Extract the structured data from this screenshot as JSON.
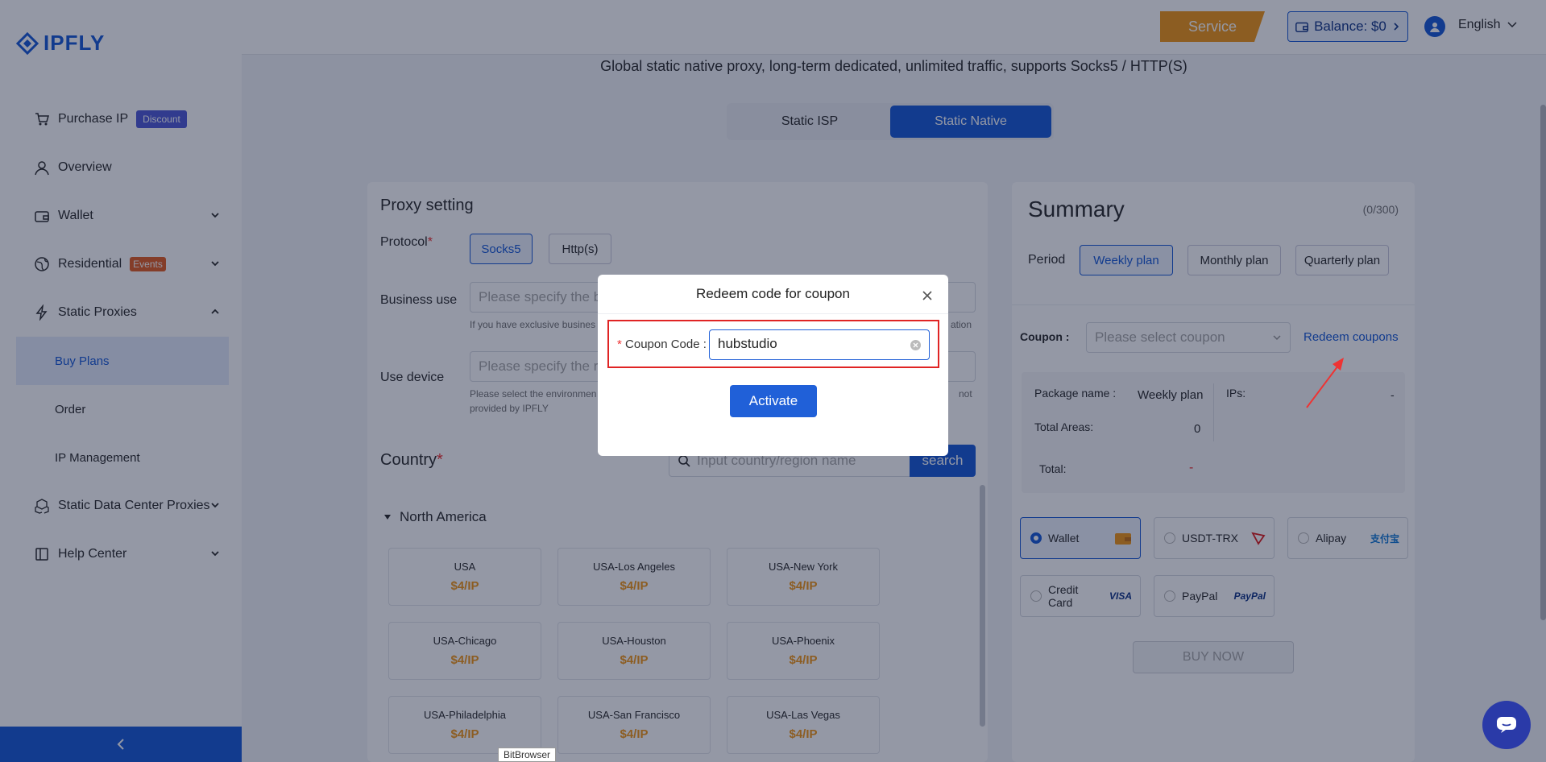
{
  "brand": {
    "logo_text": "IPFLY",
    "accent": "#2060d8"
  },
  "sidebar": {
    "items": [
      {
        "label": "Purchase IP",
        "icon": "cart-icon",
        "badge": "Discount"
      },
      {
        "label": "Overview",
        "icon": "user-icon"
      },
      {
        "label": "Wallet",
        "icon": "wallet-icon"
      },
      {
        "label": "Residential",
        "icon": "globe-icon",
        "badge": "Events"
      },
      {
        "label": "Static Proxies",
        "icon": "bolt-icon"
      },
      {
        "label": "Static Data Center Proxies",
        "icon": "cubes-icon"
      },
      {
        "label": "Help Center",
        "icon": "book-icon"
      }
    ],
    "sub_items": [
      "Buy Plans",
      "Order",
      "IP Management"
    ]
  },
  "header": {
    "service": "Service",
    "balance": "Balance: $0",
    "language": "English"
  },
  "tagline": "Global static native proxy, long-term dedicated, unlimited traffic, supports Socks5 / HTTP(S)",
  "tabs": [
    "Static ISP",
    "Static Native"
  ],
  "proxy": {
    "title": "Proxy setting",
    "protocol_label": "Protocol",
    "protocols": [
      "Socks5",
      "Http(s)"
    ],
    "business_label": "Business use",
    "business_placeholder": "Please specify the b",
    "business_hint": "If you have exclusive busines",
    "business_hint_tail": "ation",
    "device_label": "Use device",
    "device_placeholder": "Please specify the re",
    "device_hint_1": "Please select the environmen",
    "device_hint_1_tail": "not",
    "device_hint_2": "provided by IPFLY",
    "country_title": "Country",
    "search_placeholder": "Input country/region name",
    "search_btn": "search",
    "region": "North America",
    "countries": [
      {
        "name": "USA",
        "price": "$4/IP"
      },
      {
        "name": "USA-Los Angeles",
        "price": "$4/IP"
      },
      {
        "name": "USA-New York",
        "price": "$4/IP"
      },
      {
        "name": "USA-Chicago",
        "price": "$4/IP"
      },
      {
        "name": "USA-Houston",
        "price": "$4/IP"
      },
      {
        "name": "USA-Phoenix",
        "price": "$4/IP"
      },
      {
        "name": "USA-Philadelphia",
        "price": "$4/IP"
      },
      {
        "name": "USA-San Francisco",
        "price": "$4/IP"
      },
      {
        "name": "USA-Las Vegas",
        "price": "$4/IP"
      }
    ]
  },
  "summary": {
    "title": "Summary",
    "count": "(0/300)",
    "period_label": "Period",
    "plans": [
      "Weekly plan",
      "Monthly plan",
      "Quarterly plan"
    ],
    "coupon_label": "Coupon :",
    "coupon_placeholder": "Please select coupon",
    "redeem_link": "Redeem coupons",
    "package_label": "Package name :",
    "package_value": "Weekly plan",
    "ips_label": "IPs:",
    "ips_value": "-",
    "areas_label": "Total Areas:",
    "areas_value": "0",
    "total_label": "Total:",
    "total_value": "-",
    "payments": [
      {
        "label": "Wallet",
        "logo": "wallet-logo-icon"
      },
      {
        "label": "USDT-TRX",
        "logo": "tron-icon"
      },
      {
        "label": "Alipay",
        "logo": "支付宝"
      },
      {
        "label": "Credit Card",
        "logo": "VISA"
      },
      {
        "label": "PayPal",
        "logo": "PayPal"
      }
    ],
    "buy_btn": "BUY NOW"
  },
  "modal": {
    "title": "Redeem code for coupon",
    "coupon_label": "Coupon Code :",
    "coupon_value": "hubstudio",
    "activate": "Activate"
  },
  "browser_tag": "BitBrowser"
}
